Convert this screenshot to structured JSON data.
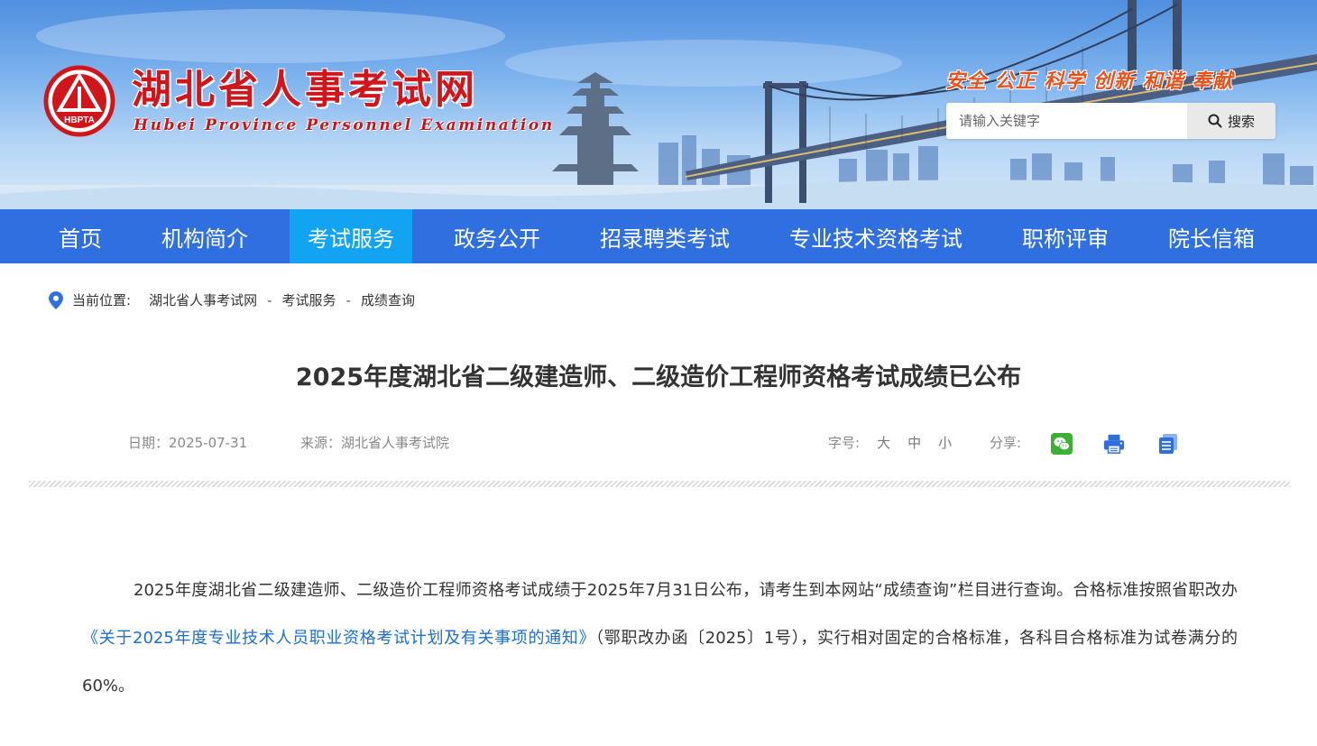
{
  "header": {
    "logo_text": "HBPTA",
    "site_title": "湖北省人事考试网",
    "site_subtitle": "Hubei Province Personnel Examination",
    "slogan": "安全 公正 科学 创新 和谐 奉献",
    "search": {
      "placeholder": "请输入关键字",
      "button_label": "搜索",
      "icon": "search-icon"
    }
  },
  "nav": {
    "items": [
      {
        "label": "首页",
        "active": false
      },
      {
        "label": "机构简介",
        "active": false
      },
      {
        "label": "考试服务",
        "active": true
      },
      {
        "label": "政务公开",
        "active": false
      },
      {
        "label": "招录聘类考试",
        "active": false
      },
      {
        "label": "专业技术资格考试",
        "active": false
      },
      {
        "label": "职称评审",
        "active": false
      },
      {
        "label": "院长信箱",
        "active": false
      }
    ]
  },
  "breadcrumb": {
    "label": "当前位置:",
    "items": [
      "湖北省人事考试网",
      "考试服务",
      "成绩查询"
    ],
    "separator": "-"
  },
  "article": {
    "title": "2025年度湖北省二级建造师、二级造价工程师资格考试成绩已公布",
    "date": "日期：2025-07-31",
    "source": "来源：湖北省人事考试院",
    "font_size_label": "字号:",
    "font_size_options": [
      "大",
      "中",
      "小"
    ],
    "share_label": "分享:",
    "share_icons": [
      "wechat-icon",
      "print-icon",
      "copy-icon"
    ],
    "content": {
      "part1": "2025年度湖北省二级建造师、二级造价工程师资格考试成绩于2025年7月31日公布，请考生到本网站“成绩查询”栏目进行查询。合格标准按照省职改办",
      "link": "《关于2025年度专业技术人员职业资格考试计划及有关事项的通知》",
      "part2": "（鄂职改办函〔2025〕1号），实行相对固定的合格标准，各科目合格标准为试卷满分的60%。"
    }
  },
  "colors": {
    "nav_bg": "#2f6fe0",
    "nav_active": "#12a3f2",
    "title_red": "#d0161b",
    "slogan_orange": "#e8531d",
    "link_blue": "#1a6fd1"
  }
}
